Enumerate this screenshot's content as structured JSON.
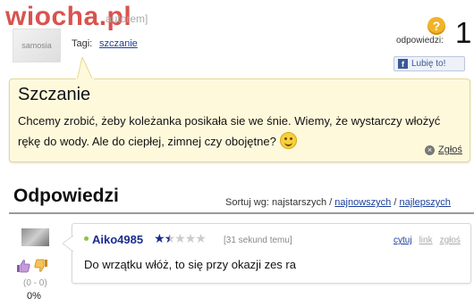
{
  "header": {
    "site_watermark": "wiocha.pl",
    "author_partial": "autorem]",
    "avatar_text": "samosia",
    "tags_label": "Tagi:",
    "tag": "szczanie"
  },
  "stats": {
    "answers_label": "odpowiedzi:",
    "answers_count": "1",
    "badge_symbol": "?"
  },
  "like_button": {
    "label": "Lubię to!",
    "icon_letter": "f"
  },
  "question": {
    "title": "Szczanie",
    "body": "Chcemy zrobić, żeby koleżanka posikała sie we śnie. Wiemy, że wystarczy włożyć rękę do wody. Ale do ciepłej, zimnej czy obojętne?",
    "report_label": "Zgłoś"
  },
  "answers_section": {
    "title": "Odpowiedzi",
    "sort_label": "Sortuj wg:",
    "sort_options": [
      "najstarszych",
      "najnowszych",
      "najlepszych"
    ],
    "separator": " / "
  },
  "answer": {
    "user": "Aiko4985",
    "rating": 1.5,
    "rating_max": 5,
    "time": "[31 sekund temu]",
    "actions": {
      "quote": "cytuj",
      "link": "link",
      "report": "zgłoś"
    },
    "text": "Do wrzątku włóż, to się przy okazji zes ra",
    "votes": "(0 - 0)",
    "percent": "0%"
  },
  "colors": {
    "link": "#1a3f9b",
    "question_bg": "#fff9dc",
    "badge": "#f0b429",
    "facebook": "#3b5998"
  }
}
